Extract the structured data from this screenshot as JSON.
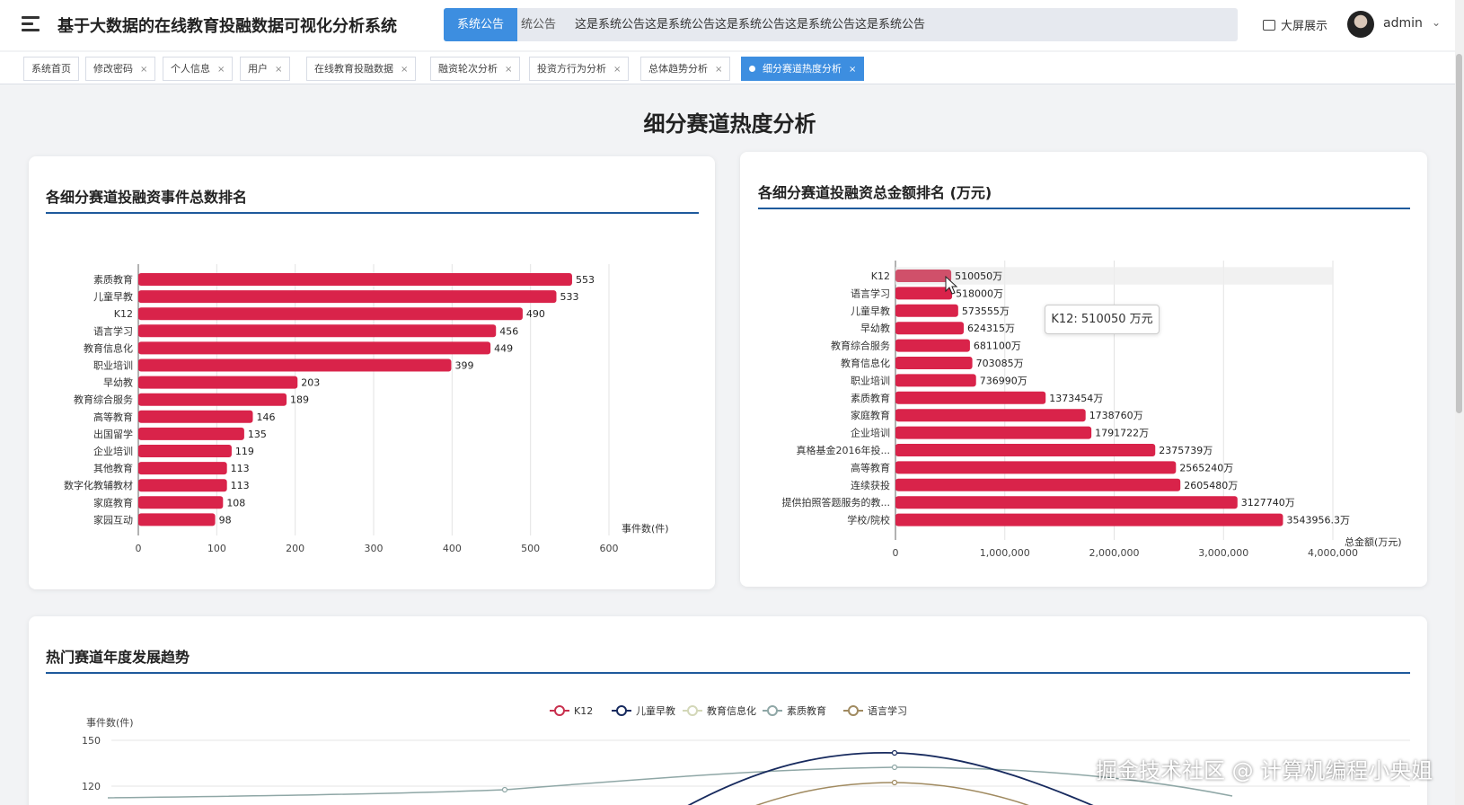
{
  "header": {
    "title": "基于大数据的在线教育投融数据可视化分析系统",
    "notice_label": "系统公告",
    "notice_prefix": "统公告",
    "notice_text": "这是系统公告这是系统公告这是系统公告这是系统公告这是系统公告",
    "bigscreen_label": "大屏展示",
    "username": "admin"
  },
  "tabs": [
    {
      "label": "系统首页",
      "closable": false
    },
    {
      "label": "修改密码",
      "closable": true
    },
    {
      "label": "个人信息",
      "closable": true
    },
    {
      "label": "用户",
      "closable": true
    },
    {
      "label": "在线教育投融数据",
      "closable": true
    },
    {
      "label": "融资轮次分析",
      "closable": true
    },
    {
      "label": "投资方行为分析",
      "closable": true
    },
    {
      "label": "总体趋势分析",
      "closable": true
    },
    {
      "label": "细分赛道热度分析",
      "closable": true,
      "active": true
    }
  ],
  "tab_close": "×",
  "page_title": "细分赛道热度分析",
  "chart_data": [
    {
      "type": "bar",
      "orientation": "horizontal",
      "title": "各细分赛道投融资事件总数排名",
      "xlabel": "事件数(件)",
      "categories": [
        "素质教育",
        "儿童早教",
        "K12",
        "语言学习",
        "教育信息化",
        "职业培训",
        "早幼教",
        "教育综合服务",
        "高等教育",
        "出国留学",
        "企业培训",
        "其他教育",
        "数字化教辅教材",
        "家庭教育",
        "家园互动"
      ],
      "values": [
        553,
        533,
        490,
        456,
        449,
        399,
        203,
        189,
        146,
        135,
        119,
        113,
        113,
        108,
        98
      ],
      "xlim": [
        0,
        600
      ],
      "xticks": [
        "0",
        "100",
        "200",
        "300",
        "400",
        "500",
        "600"
      ],
      "color": "#d9234a"
    },
    {
      "type": "bar",
      "orientation": "horizontal",
      "title": "各细分赛道投融资总金额排名 (万元)",
      "xlabel": "总金额(万元)",
      "categories": [
        "K12",
        "语言学习",
        "儿童早教",
        "早幼教",
        "教育综合服务",
        "教育信息化",
        "职业培训",
        "素质教育",
        "家庭教育",
        "企业培训",
        "真格基金2016年投...",
        "高等教育",
        "连续获投",
        "提供拍照答题服务的教...",
        "学校/院校"
      ],
      "values": [
        510050,
        518000,
        573555,
        624315,
        681100,
        703085,
        736990,
        1373454,
        1738760,
        1791722,
        2375739,
        2565240,
        2605480,
        3127740,
        3543956.3
      ],
      "labels": [
        "510050万",
        "518000万",
        "573555万",
        "624315万",
        "681100万",
        "703085万",
        "736990万",
        "1373454万",
        "1738760万",
        "1791722万",
        "2375739万",
        "2565240万",
        "2605480万",
        "3127740万",
        "3543956.3万"
      ],
      "xlim": [
        0,
        4000000
      ],
      "xticks": [
        "0",
        "1,000,000",
        "2,000,000",
        "3,000,000",
        "4,000,000"
      ],
      "color": "#d9234a",
      "highlight_index": 0,
      "tooltip": "K12: 510050 万元"
    },
    {
      "type": "line",
      "title": "热门赛道年度发展趋势",
      "ylabel": "事件数(件)",
      "yticks": [
        "150",
        "120"
      ],
      "series": [
        {
          "name": "K12",
          "color": "#c8304e"
        },
        {
          "name": "儿童早教",
          "color": "#172a5e"
        },
        {
          "name": "教育信息化",
          "color": "#d3d7b8"
        },
        {
          "name": "素质教育",
          "color": "#8fa7a6"
        },
        {
          "name": "语言学习",
          "color": "#a08a60"
        }
      ]
    }
  ],
  "watermark": "掘金技术社区 @ 计算机编程小央姐"
}
